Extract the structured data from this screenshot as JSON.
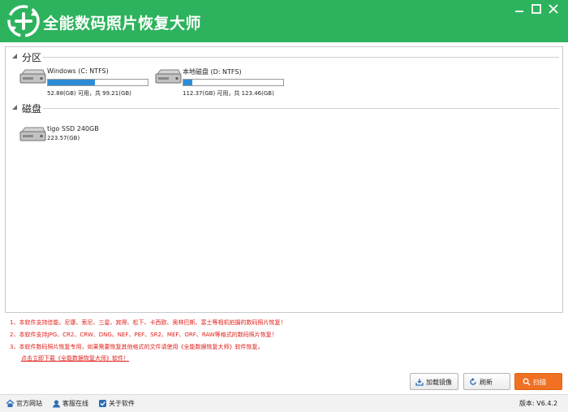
{
  "app": {
    "title": "全能数码照片恢复大师",
    "accent_color": "#2db35d"
  },
  "window_controls": {
    "minimize_icon": "minimize-icon",
    "maximize_icon": "maximize-icon",
    "close_icon": "close-icon"
  },
  "partitions": {
    "label": "分区",
    "items": [
      {
        "name": "Windows (C: NTFS)",
        "info": "52.88(GB) 可用，共 99.21(GB)",
        "used_fraction": 0.47
      },
      {
        "name": "本地磁盘 (D: NTFS)",
        "info": "112.37(GB) 可用，共 123.46(GB)",
        "used_fraction": 0.09
      }
    ]
  },
  "disks": {
    "label": "磁盘",
    "items": [
      {
        "name": "tigo SSD 240GB",
        "info": "223.57(GB)"
      }
    ]
  },
  "notes": {
    "line1": "1、本软件支持佳能、尼康、索尼、三星、宾得、松下、卡西欧、奥林巴斯、富士等相机拍摄的数码照片恢复！",
    "line2": "2、本软件支持JPG、CR2、CRW、DNG、NEF、PEF、SR2、MEF、ORF、RAW等格式的数码照片恢复！",
    "line3": "3、本软件数码照片恢复专用，如果需要恢复其他格式的文件请使用《全能数据恢复大师》软件恢复。",
    "download_link": "点击立即下载《全能数据恢复大师》软件！",
    "color": "#e0201b"
  },
  "buttons": {
    "load_image": "加载镜像",
    "refresh": "刷新",
    "scan": "扫描",
    "scan_color": "#f07124"
  },
  "footer": {
    "official_site": "官方网站",
    "customer_service": "客服在线",
    "about": "关于软件",
    "version": "版本: V6.4.2"
  }
}
